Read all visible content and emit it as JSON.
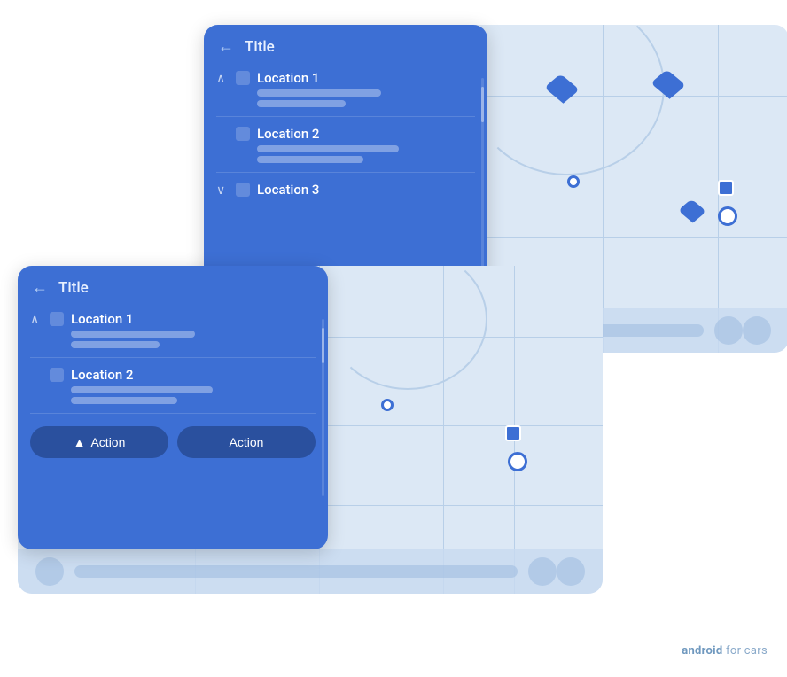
{
  "back_card": {
    "panel": {
      "title": "Title",
      "back_label": "←",
      "items": [
        {
          "label": "Location 1",
          "expanded": true,
          "bars": [
            "long",
            "medium"
          ]
        },
        {
          "label": "Location 2",
          "expanded": false,
          "bars": [
            "xlong",
            "short"
          ]
        },
        {
          "label": "Location 3",
          "expanded": false,
          "bars": []
        }
      ]
    }
  },
  "front_card": {
    "panel": {
      "title": "Title",
      "back_label": "←",
      "items": [
        {
          "label": "Location 1",
          "expanded": true,
          "bars": [
            "long",
            "medium"
          ]
        },
        {
          "label": "Location 2",
          "expanded": false,
          "bars": [
            "xlong",
            "short"
          ]
        }
      ],
      "actions": [
        {
          "label": "Action",
          "icon": "▲",
          "primary": true
        },
        {
          "label": "Action",
          "icon": "",
          "primary": false
        }
      ]
    }
  },
  "watermark": {
    "bold": "android",
    "rest": " for cars"
  }
}
